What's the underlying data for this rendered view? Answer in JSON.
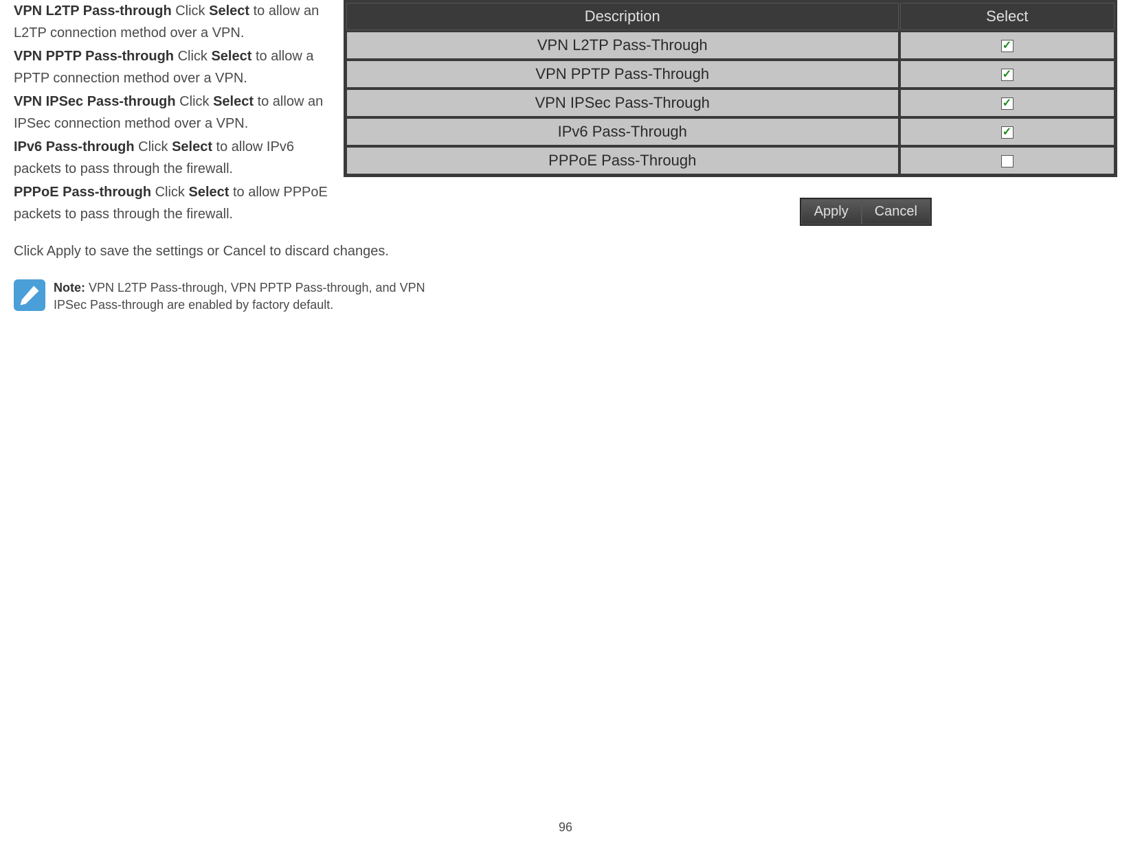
{
  "descriptions": {
    "items": [
      {
        "title": "VPN L2TP Pass-through",
        "action_prefix": " Click ",
        "action_word": "Select",
        "action_suffix": " to allow an L2TP connection method over a VPN."
      },
      {
        "title": "VPN PPTP Pass-through",
        "action_prefix": " Click ",
        "action_word": "Select",
        "action_suffix": " to allow a PPTP connection method over a VPN."
      },
      {
        "title": "VPN IPSec Pass-through",
        "action_prefix": " Click ",
        "action_word": "Select",
        "action_suffix": " to allow an IPSec connection method over a VPN."
      },
      {
        "title": "IPv6 Pass-through",
        "action_prefix": " Click ",
        "action_word": "Select",
        "action_suffix": " to allow IPv6 packets to pass through the firewall."
      },
      {
        "title": "PPPoE Pass-through",
        "action_prefix": " Click ",
        "action_word": "Select",
        "action_suffix": " to allow PPPoE packets to pass through the firewall."
      }
    ]
  },
  "table": {
    "headers": {
      "description": "Description",
      "select": "Select"
    },
    "rows": [
      {
        "description": "VPN L2TP Pass-Through",
        "checked": true
      },
      {
        "description": "VPN PPTP Pass-Through",
        "checked": true
      },
      {
        "description": "VPN IPSec Pass-Through",
        "checked": true
      },
      {
        "description": "IPv6 Pass-Through",
        "checked": true
      },
      {
        "description": "PPPoE Pass-Through",
        "checked": false
      }
    ]
  },
  "buttons": {
    "apply": "Apply",
    "cancel": "Cancel"
  },
  "footer_text": {
    "prefix": "Click ",
    "apply": "Apply",
    "middle": " to save the settings or ",
    "cancel": "Cancel",
    "suffix": " to discard changes."
  },
  "note": {
    "label": "Note:",
    "text": " VPN L2TP Pass-through, VPN PPTP Pass-through, and VPN IPSec Pass-through are enabled by factory default."
  },
  "page_number": "96"
}
